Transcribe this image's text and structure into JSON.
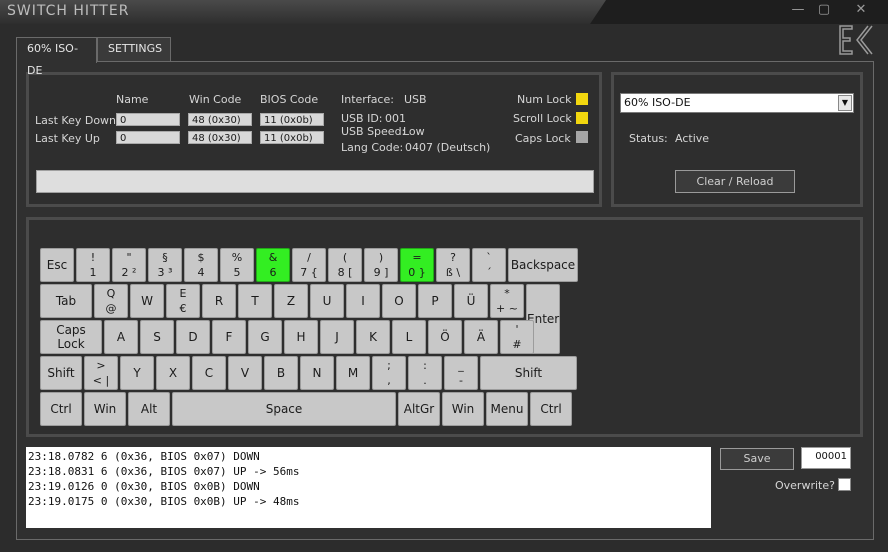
{
  "window": {
    "title": "SWITCH HITTER",
    "minimize_glyph": "—",
    "maximize_glyph": "▢",
    "close_glyph": "✕"
  },
  "tabs": [
    {
      "label": "60% ISO-DE",
      "active": true
    },
    {
      "label": "SETTINGS",
      "active": false
    }
  ],
  "info": {
    "headers": {
      "name": "Name",
      "win_code": "Win Code",
      "bios_code": "BIOS Code"
    },
    "last_key_down": {
      "label": "Last Key Down",
      "name": "0",
      "win_code": "48 (0x30)",
      "bios_code": "11 (0x0b)"
    },
    "last_key_up": {
      "label": "Last Key Up",
      "name": "0",
      "win_code": "48 (0x30)",
      "bios_code": "11 (0x0b)"
    },
    "device": {
      "interface_label": "Interface:",
      "interface_value": "USB",
      "usb_id_label": "USB ID:",
      "usb_id_value": "001",
      "usb_speed_label": "USB Speed:",
      "usb_speed_value": "Low",
      "lang_code_label": "Lang Code:",
      "lang_code_value": "0407 (Deutsch)"
    },
    "locks": [
      {
        "label": "Num Lock",
        "state": "on",
        "color": "#f2d70f"
      },
      {
        "label": "Scroll Lock",
        "state": "on",
        "color": "#f2d70f"
      },
      {
        "label": "Caps Lock",
        "state": "off",
        "color": "#a6a6a6"
      }
    ]
  },
  "layout_panel": {
    "selected_layout": "60% ISO-DE",
    "status_label": "Status:",
    "status_value": "Active",
    "reload_button": "Clear / Reload"
  },
  "colors": {
    "key": "#c8c8c8",
    "key_active": "#33ee22",
    "indicator_on": "#f2d70f",
    "indicator_off": "#a6a6a6"
  },
  "keyboard": {
    "rows": [
      [
        {
          "id": "esc",
          "label": "Esc"
        },
        {
          "id": "1",
          "top": "!",
          "bottom": "1"
        },
        {
          "id": "2",
          "top": "\"",
          "bottom": "2 ²"
        },
        {
          "id": "3",
          "top": "§",
          "bottom": "3 ³"
        },
        {
          "id": "4",
          "top": "$",
          "bottom": "4"
        },
        {
          "id": "5",
          "top": "%",
          "bottom": "5"
        },
        {
          "id": "6",
          "top": "&",
          "bottom": "6",
          "active": true
        },
        {
          "id": "7",
          "top": "/",
          "bottom": "7 {"
        },
        {
          "id": "8",
          "top": "(",
          "bottom": "8 ["
        },
        {
          "id": "9",
          "top": ")",
          "bottom": "9 ]"
        },
        {
          "id": "0",
          "top": "=",
          "bottom": "0 }",
          "active": true
        },
        {
          "id": "sz",
          "top": "?",
          "bottom": "ß \\"
        },
        {
          "id": "acute",
          "top": "`",
          "bottom": "´"
        },
        {
          "id": "backspace",
          "label": "Backspace"
        }
      ],
      [
        {
          "id": "tab",
          "label": "Tab"
        },
        {
          "id": "q",
          "top": "Q",
          "bottom": "@"
        },
        {
          "id": "w",
          "label": "W"
        },
        {
          "id": "e",
          "top": "E",
          "bottom": "€"
        },
        {
          "id": "r",
          "label": "R"
        },
        {
          "id": "t",
          "label": "T"
        },
        {
          "id": "z",
          "label": "Z"
        },
        {
          "id": "u",
          "label": "U"
        },
        {
          "id": "i",
          "label": "I"
        },
        {
          "id": "o",
          "label": "O"
        },
        {
          "id": "p",
          "label": "P"
        },
        {
          "id": "ue",
          "label": "Ü"
        },
        {
          "id": "plus",
          "top": "*",
          "bottom": "+ ~"
        },
        {
          "id": "enter",
          "label": "Enter"
        }
      ],
      [
        {
          "id": "capslock",
          "label": "Caps Lock"
        },
        {
          "id": "a",
          "label": "A"
        },
        {
          "id": "s",
          "label": "S"
        },
        {
          "id": "d",
          "label": "D"
        },
        {
          "id": "f",
          "label": "F"
        },
        {
          "id": "g",
          "label": "G"
        },
        {
          "id": "h",
          "label": "H"
        },
        {
          "id": "j",
          "label": "J"
        },
        {
          "id": "k",
          "label": "K"
        },
        {
          "id": "l",
          "label": "L"
        },
        {
          "id": "oe",
          "label": "Ö"
        },
        {
          "id": "ae",
          "label": "Ä"
        },
        {
          "id": "hash",
          "top": "'",
          "bottom": "#"
        }
      ],
      [
        {
          "id": "lshift",
          "label": "Shift"
        },
        {
          "id": "lt",
          "top": ">",
          "bottom": "< |"
        },
        {
          "id": "y",
          "label": "Y"
        },
        {
          "id": "x",
          "label": "X"
        },
        {
          "id": "c",
          "label": "C"
        },
        {
          "id": "v",
          "label": "V"
        },
        {
          "id": "b",
          "label": "B"
        },
        {
          "id": "n",
          "label": "N"
        },
        {
          "id": "m",
          "label": "M"
        },
        {
          "id": "comma",
          "top": ";",
          "bottom": ","
        },
        {
          "id": "period",
          "top": ":",
          "bottom": "."
        },
        {
          "id": "minus",
          "top": "_",
          "bottom": "-"
        },
        {
          "id": "rshift",
          "label": "Shift"
        }
      ],
      [
        {
          "id": "lctrl",
          "label": "Ctrl"
        },
        {
          "id": "lwin",
          "label": "Win"
        },
        {
          "id": "alt",
          "label": "Alt"
        },
        {
          "id": "space",
          "label": "Space"
        },
        {
          "id": "altgr",
          "label": "AltGr"
        },
        {
          "id": "rwin",
          "label": "Win"
        },
        {
          "id": "menu",
          "label": "Menu"
        },
        {
          "id": "rctrl",
          "label": "Ctrl"
        }
      ]
    ]
  },
  "log": {
    "lines": [
      "23:18.0782 6 (0x36, BIOS 0x07) DOWN",
      "23:18.0831 6 (0x36, BIOS 0x07) UP -> 56ms",
      "23:19.0126 0 (0x30, BIOS 0x0B) DOWN",
      "23:19.0175 0 (0x30, BIOS 0x0B) UP -> 48ms"
    ],
    "save_button": "Save",
    "counter": "00001",
    "overwrite_label": "Overwrite?",
    "overwrite_checked": false
  }
}
